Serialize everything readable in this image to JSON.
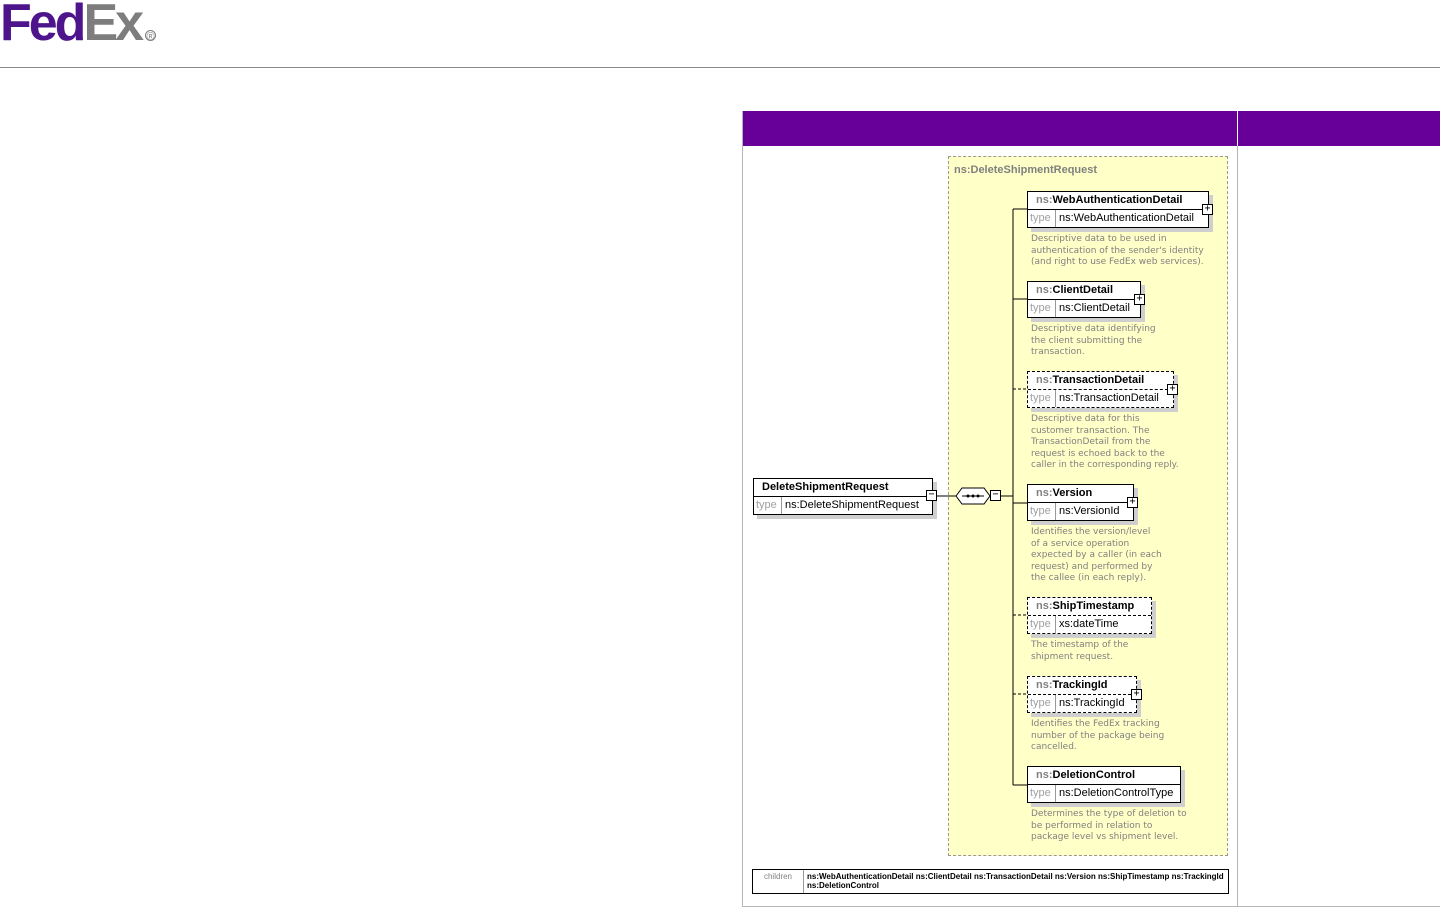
{
  "brand": {
    "fed": "Fed",
    "ex": "Ex",
    "registered": "®"
  },
  "diagram": {
    "root": {
      "name": "DeleteShipmentRequest",
      "type_key": "type",
      "type_value": "ns:DeleteShipmentRequest"
    },
    "sequence_title": "ns:DeleteShipmentRequest",
    "elements": [
      {
        "ns": "ns:",
        "local": "WebAuthenticationDetail",
        "type_key": "type",
        "type_value": "ns:WebAuthenticationDetail",
        "description": [
          "Descriptive data to be used in",
          "authentication of the sender's identity",
          "(and right to use FedEx web services)."
        ]
      },
      {
        "ns": "ns:",
        "local": "ClientDetail",
        "type_key": "type",
        "type_value": "ns:ClientDetail",
        "description": [
          "Descriptive data identifying",
          "the client submitting the",
          "transaction."
        ]
      },
      {
        "ns": "ns:",
        "local": "TransactionDetail",
        "type_key": "type",
        "type_value": "ns:TransactionDetail",
        "description": [
          "Descriptive data for this",
          "customer transaction. The",
          "TransactionDetail from the",
          "request is echoed back to the",
          "caller in the corresponding reply."
        ]
      },
      {
        "ns": "ns:",
        "local": "Version",
        "type_key": "type",
        "type_value": "ns:VersionId",
        "description": [
          "Identifies the version/level",
          "of a service operation",
          "expected by a caller (in each",
          "request) and performed by",
          "the callee (in each reply)."
        ]
      },
      {
        "ns": "ns:",
        "local": "ShipTimestamp",
        "type_key": "type",
        "type_value": "xs:dateTime",
        "description": [
          "The timestamp of the",
          "shipment request."
        ]
      },
      {
        "ns": "ns:",
        "local": "TrackingId",
        "type_key": "type",
        "type_value": "ns:TrackingId",
        "description": [
          "Identifies the FedEx tracking",
          "number of the package being",
          "cancelled."
        ]
      },
      {
        "ns": "ns:",
        "local": "DeletionControl",
        "type_key": "type",
        "type_value": "ns:DeletionControlType",
        "description": [
          "Determines the type of deletion to",
          "be performed in relation to",
          "package level vs shipment level."
        ]
      }
    ],
    "children": {
      "label": "children",
      "line1": "ns:WebAuthenticationDetail ns:ClientDetail ns:TransactionDetail ns:Version ns:ShipTimestamp ns:TrackingId",
      "line2": "ns:DeletionControl"
    }
  },
  "colors": {
    "header": "#660099",
    "sequence_bg": "#ffffc8",
    "fedex_purple": "#4d148c",
    "fedex_gray": "#7d7d7d"
  }
}
